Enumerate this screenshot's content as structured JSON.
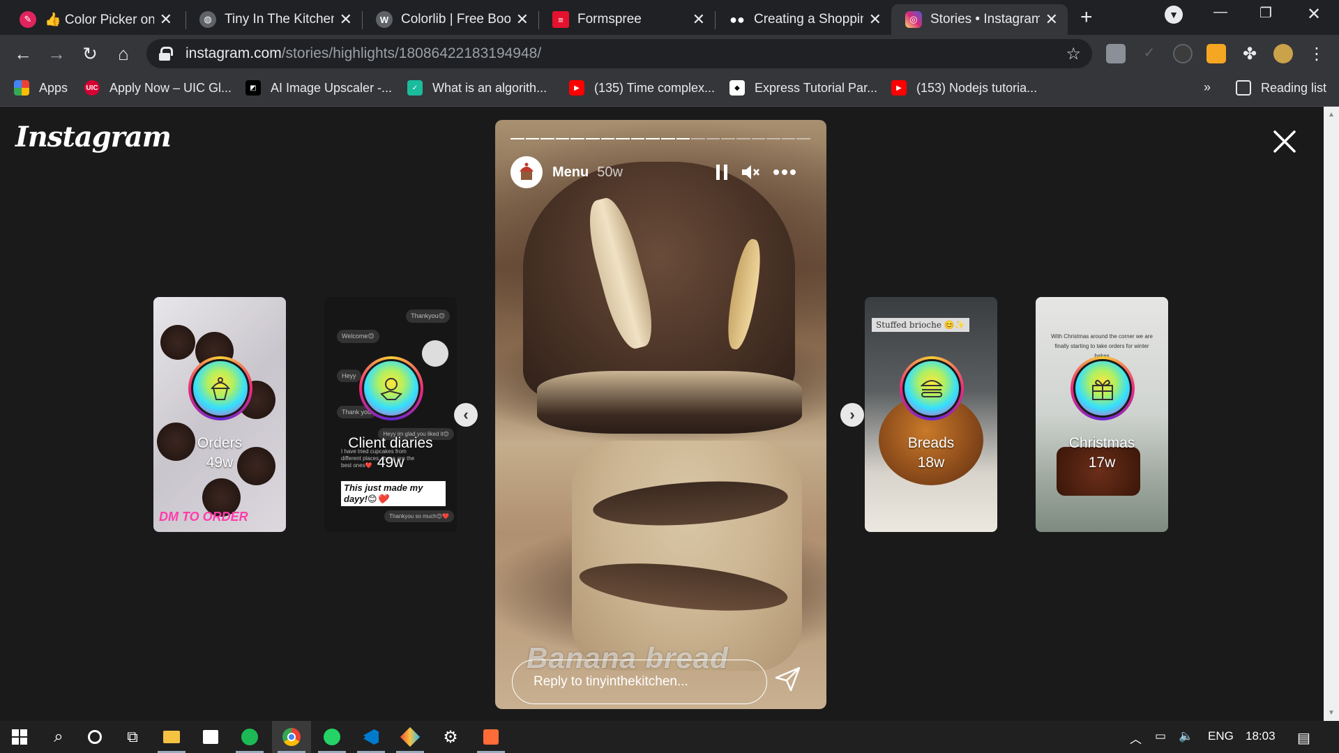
{
  "browser": {
    "tabs": [
      {
        "title": "👍 Color Picker onli",
        "favicon_color": "#e0245e",
        "favicon_icon": "color-picker-icon"
      },
      {
        "title": "Tiny In The Kitchen",
        "favicon_color": "#5f6368",
        "favicon_icon": "globe-icon"
      },
      {
        "title": "Colorlib | Free Boots",
        "favicon_color": "#5f6368",
        "favicon_icon": "wordpress-icon"
      },
      {
        "title": "Formspree",
        "favicon_color": "#e5122e",
        "favicon_icon": "formspree-icon"
      },
      {
        "title": "Creating a Shoppin",
        "favicon_color": "#ffffff",
        "favicon_icon": "medium-icon"
      },
      {
        "title": "Stories • Instagram",
        "favicon_color": "#d62976",
        "favicon_icon": "instagram-icon",
        "active": true
      }
    ],
    "url_host": "instagram.com",
    "url_path": "/stories/highlights/18086422183194948/",
    "bookmarks": [
      {
        "label": "Apps"
      },
      {
        "label": "Apply Now – UIC Gl..."
      },
      {
        "label": "AI Image Upscaler -..."
      },
      {
        "label": "What is an algorith..."
      },
      {
        "label": "(135) Time complex..."
      },
      {
        "label": "Express Tutorial Par..."
      },
      {
        "label": "(153) Nodejs tutoria..."
      }
    ],
    "overflow_label": "»",
    "reading_list": "Reading list"
  },
  "instagram": {
    "logo": "Instagram",
    "highlights_left": [
      {
        "name": "Orders",
        "age": "49w",
        "caption": "DM TO ORDER"
      },
      {
        "name": "Client diaries",
        "age": "49w",
        "chat_lines": [
          "Thankyou😊",
          "Welcome😊",
          "Heyy",
          "Thank you",
          "Heyy im glad you liked it😊",
          "I have tried cupcakes from different places, these are the best ones❤️",
          "This just made my dayy!😊❤️",
          "Thankyou so much😊❤️"
        ]
      }
    ],
    "highlights_right": [
      {
        "name": "Breads",
        "age": "18w",
        "caption": "Stuffed brioche 😊✨"
      },
      {
        "name": "Christmas",
        "age": "17w",
        "caption": "With Christmas around the corner we are finally starting to take orders for winter bakes"
      }
    ],
    "story": {
      "user": "Menu",
      "time": "50w",
      "segments_total": 20,
      "segments_done": 12,
      "overlay_text": "Banana bread",
      "reply_placeholder": "Reply to tinyinthekitchen..."
    }
  },
  "taskbar": {
    "language": "ENG",
    "time": "18:03"
  }
}
